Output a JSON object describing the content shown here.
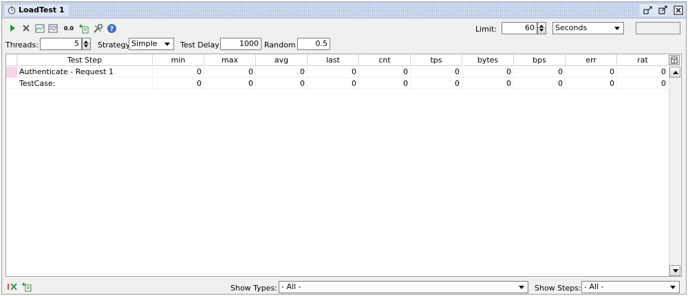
{
  "window": {
    "title": "LoadTest 1",
    "icon": "stopwatch-icon",
    "buttons": [
      "detach-icon",
      "restore-icon",
      "close-icon"
    ]
  },
  "toolbar": {
    "icons": [
      "run-icon",
      "cancel-icon",
      "statistics-graph-icon",
      "statistics-history-icon",
      "reset-statistics-icon",
      "add-assertion-icon",
      "options-tools-icon",
      "help-icon"
    ],
    "reset_label": "0.0",
    "limit_label": "Limit:",
    "limit_value": "60",
    "limit_unit": "Seconds"
  },
  "settings": {
    "threads_label": "Threads:",
    "threads_value": "5",
    "strategy_label": "Strategy",
    "strategy_value": "Simple",
    "test_delay_label": "Test Delay",
    "test_delay_value": "1000",
    "random_label": "Random",
    "random_value": "0.5"
  },
  "table": {
    "columns": [
      "Test Step",
      "min",
      "max",
      "avg",
      "last",
      "cnt",
      "tps",
      "bytes",
      "bps",
      "err",
      "rat"
    ],
    "rows": [
      {
        "name": "Authenticate - Request 1",
        "values": [
          "0",
          "0",
          "0",
          "0",
          "0",
          "0",
          "0",
          "0",
          "0",
          "0"
        ],
        "marker_color": "#f6d6ea"
      },
      {
        "name": "TestCase:",
        "values": [
          "0",
          "0",
          "0",
          "0",
          "0",
          "0",
          "0",
          "0",
          "0",
          "0"
        ],
        "marker_color": ""
      }
    ]
  },
  "bottom": {
    "icons": [
      "remove-assertion-icon",
      "add-assertion-icon"
    ],
    "show_types_label": "Show Types:",
    "show_types_value": "- All -",
    "show_steps_label": "Show Steps:",
    "show_steps_value": "- All -"
  },
  "colors": {
    "titlebar": "#dbe6f6",
    "run_green": "#1a9a2e",
    "help_blue": "#3a6fc4",
    "row_marker": "#f6d6ea"
  }
}
